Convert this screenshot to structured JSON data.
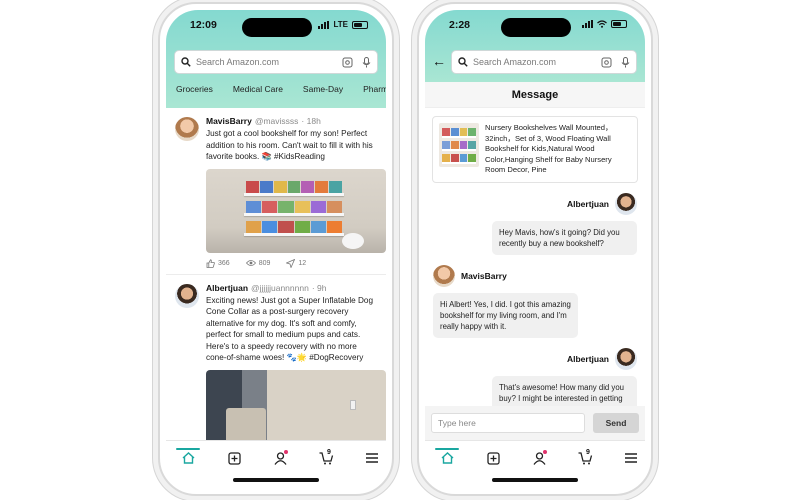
{
  "left_phone": {
    "status": {
      "time": "12:09",
      "network": "LTE"
    },
    "search": {
      "placeholder": "Search Amazon.com"
    },
    "categories": [
      "Groceries",
      "Medical Care",
      "Same-Day",
      "Pharmac"
    ],
    "posts": [
      {
        "name": "MavisBarry",
        "handle": "@mavissss",
        "time": "· 18h",
        "text": "Just got a cool bookshelf for my son! Perfect addition to his room. Can't wait to fill it with his favorite books. 📚 #KidsReading",
        "likes": "366",
        "views": "809",
        "shares": "12"
      },
      {
        "name": "Albertjuan",
        "handle": "@jjjjjjuannnnnn",
        "time": "· 9h",
        "text": "Exciting news! Just got a Super Inflatable Dog Cone Collar as a post-surgery recovery alternative for my dog. It's soft and comfy, perfect for small to medium pups and cats. Here's to a speedy recovery with no more cone-of-shame woes! 🐾🌟 #DogRecovery"
      }
    ]
  },
  "right_phone": {
    "status": {
      "time": "2:28"
    },
    "search": {
      "placeholder": "Search Amazon.com"
    },
    "title": "Message",
    "product": {
      "title": "Nursery Bookshelves Wall Mounted，32inch，Set of 3, Wood Floating Wall Bookshelf for Kids,Natural Wood Color,Hanging Shelf for Baby Nursery Room Decor, Pine"
    },
    "messages": [
      {
        "sender": "Albertjuan",
        "side": "right",
        "text": "Hey Mavis, how's it going? Did you recently buy a new bookshelf?"
      },
      {
        "sender": "MavisBarry",
        "side": "left",
        "text": "Hi Albert! Yes, I did. I got this amazing bookshelf for my living room, and I'm really happy with it."
      },
      {
        "sender": "Albertjuan",
        "side": "right",
        "text": "That's awesome! How many did you buy? I might be interested in getting"
      }
    ],
    "input": {
      "placeholder": "Type here"
    },
    "send_label": "Send"
  },
  "tab_bar": {
    "items": [
      "home-icon",
      "add-post-icon",
      "profile-icon",
      "cart-icon",
      "menu-icon"
    ],
    "cart_count": "9",
    "active_color": "#1aa7a0",
    "badge_color": "#e0336b"
  }
}
